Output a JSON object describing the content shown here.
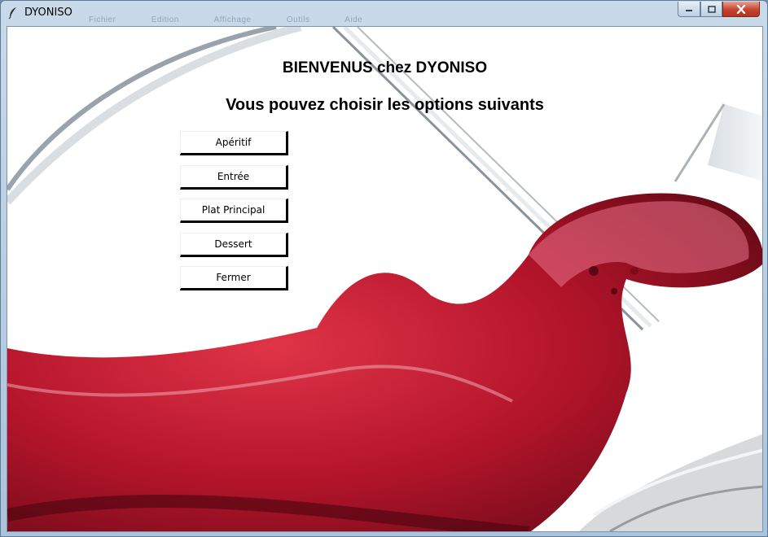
{
  "window": {
    "title": "DYONISO",
    "ghost_menu": [
      "Fichier",
      "Edition",
      "Affichage",
      "Outils",
      "Aide"
    ]
  },
  "main": {
    "welcome": "BIENVENUS chez DYONISO",
    "subtitle": "Vous pouvez choisir les options suivants",
    "buttons": {
      "aperitif": "Apéritif",
      "entree": "Entrée",
      "plat": "Plat Principal",
      "dessert": "Dessert",
      "fermer": "Fermer"
    }
  },
  "colors": {
    "wine": "#b3142a",
    "wine_dark": "#5c0814",
    "close_button": "#c5432f"
  },
  "icons": {
    "app": "feather-icon",
    "minimize": "minimize-icon",
    "maximize": "maximize-icon",
    "close": "close-icon"
  }
}
